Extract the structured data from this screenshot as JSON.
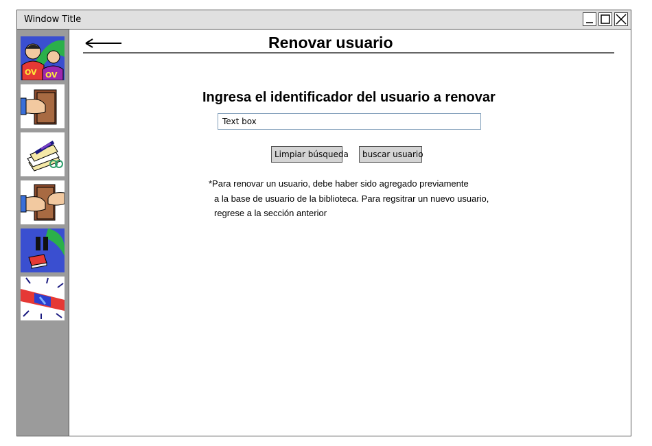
{
  "window": {
    "title": "Window Title",
    "controls": [
      "minimize-icon",
      "maximize-icon",
      "close-icon"
    ]
  },
  "sidebar": {
    "items": [
      {
        "name": "users-icon"
      },
      {
        "name": "book-hand-icon"
      },
      {
        "name": "documents-pen-icon"
      },
      {
        "name": "book-exchange-icon"
      },
      {
        "name": "pause-book-icon"
      },
      {
        "name": "alarm-siren-icon"
      }
    ]
  },
  "header": {
    "back_icon": "arrow-left-icon",
    "title": "Renovar usuario"
  },
  "form": {
    "prompt": "Ingresa el identificador del usuario a renovar",
    "input_value": "Text box",
    "clear_button": "Limpiar búsqueda",
    "search_button": "buscar usuario"
  },
  "note": {
    "line1": "*Para renovar un usuario, debe haber sido agregado previamente",
    "line2": "a la base de usuario de la biblioteca. Para regsitrar un nuevo usuario,",
    "line3": "regrese a la sección anterior"
  }
}
